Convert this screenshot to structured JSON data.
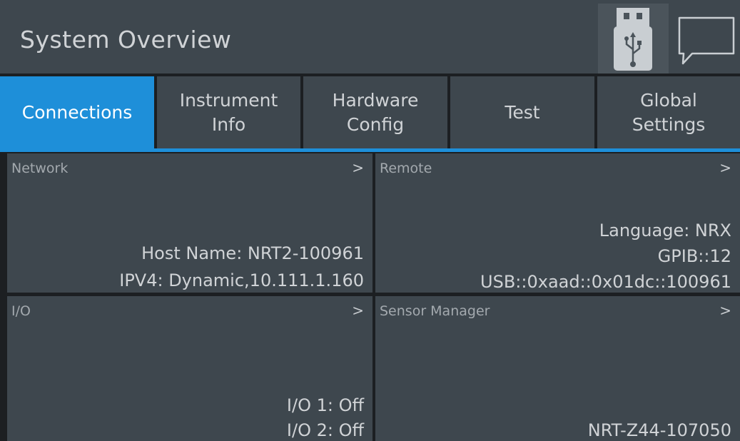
{
  "header": {
    "title": "System Overview",
    "usb_icon": "usb-icon",
    "message_icon": "message-icon"
  },
  "tabs": [
    {
      "line1": "Connections",
      "line2": ""
    },
    {
      "line1": "Instrument",
      "line2": "Info"
    },
    {
      "line1": "Hardware",
      "line2": "Config"
    },
    {
      "line1": "Test",
      "line2": ""
    },
    {
      "line1": "Global",
      "line2": "Settings"
    }
  ],
  "panels": {
    "network": {
      "title": "Network",
      "host_name": "Host Name: NRT2-100961",
      "ipv4": "IPV4: Dynamic,10.111.1.160"
    },
    "remote": {
      "title": "Remote",
      "language": "Language: NRX",
      "gpib": "GPIB::12",
      "usb": "USB::0xaad::0x01dc::100961"
    },
    "io": {
      "title": "I/O",
      "io1": "I/O 1: Off",
      "io2": "I/O 2: Off"
    },
    "sensor_manager": {
      "title": "Sensor Manager",
      "sensor": "NRT-Z44-107050"
    }
  },
  "chevron": ">",
  "colors": {
    "accent": "#1e8fd9",
    "panel": "#3e474e",
    "background": "#1c1f22"
  }
}
